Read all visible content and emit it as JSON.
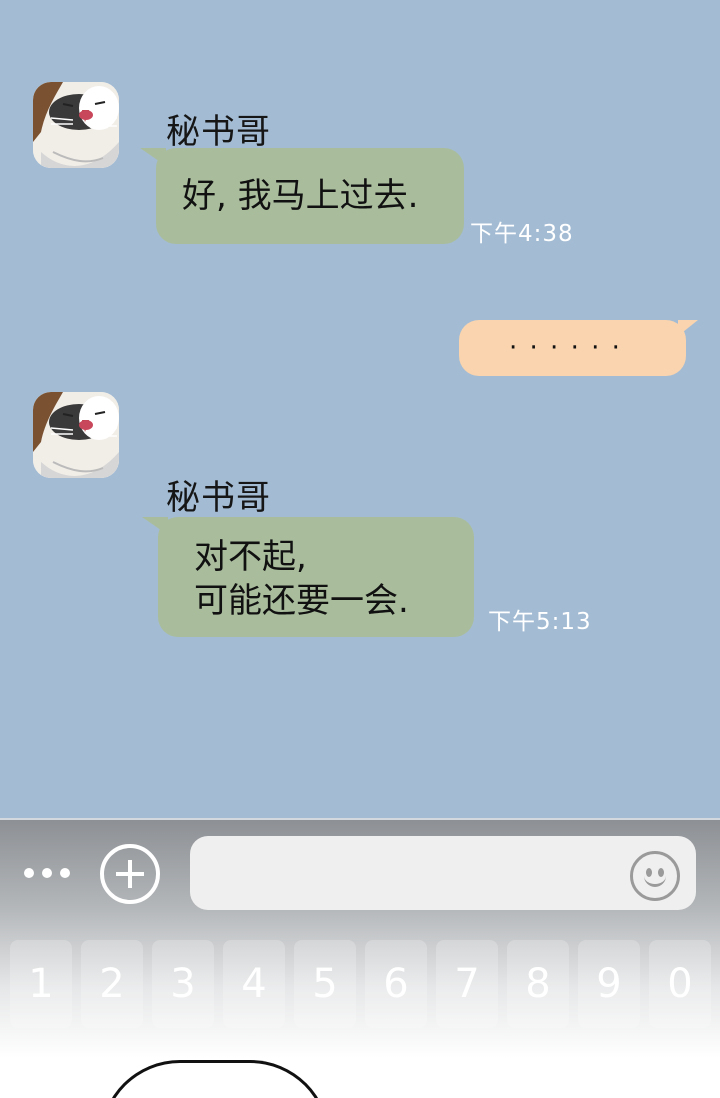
{
  "messages": [
    {
      "sender": "秘书哥",
      "text": "好, 我马上过去.",
      "time": "下午4:38"
    },
    {
      "text": "· · · · · ·"
    },
    {
      "sender": "秘书哥",
      "text": "对不起,\n可能还要一会.",
      "time": "下午5:13"
    }
  ],
  "input_bar": {
    "more_icon": "more-dots-icon",
    "plus_icon": "plus-circle-icon",
    "emoji_icon": "smiley-icon",
    "input_value": "",
    "input_placeholder": ""
  },
  "keys": [
    "1",
    "2",
    "3",
    "4",
    "5",
    "6",
    "7",
    "8",
    "9",
    "0"
  ],
  "colors": {
    "chat_background": "#a3bcd4",
    "incoming_bubble": "#a9bd9d",
    "outgoing_bubble": "#f9d4ae",
    "timestamp": "#ffffff"
  }
}
